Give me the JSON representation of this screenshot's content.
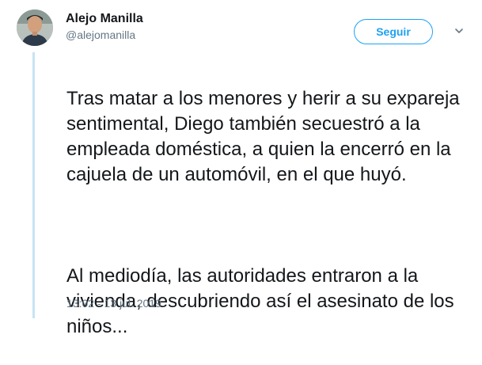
{
  "tweet": {
    "display_name": "Alejo Manilla",
    "handle": "@alejomanilla",
    "follow_label": "Seguir",
    "paragraphs": [
      "Tras matar a los menores y herir a su expareja sentimental, Diego también secuestró a la empleada doméstica, a quien la encerró en la cajuela de un automóvil, en el que huyó.",
      "Al mediodía, las autoridades entraron a la vivienda, descubriendo así el asesinato de los niños..."
    ],
    "timestamp": "13:02 - 13 jul. 2019"
  },
  "icons": {
    "avatar": "user-photo",
    "menu": "chevron-down-icon"
  },
  "colors": {
    "accent": "#1da1f2",
    "text": "#14171a",
    "muted": "#657786",
    "thread_line": "#c7e3f6"
  }
}
